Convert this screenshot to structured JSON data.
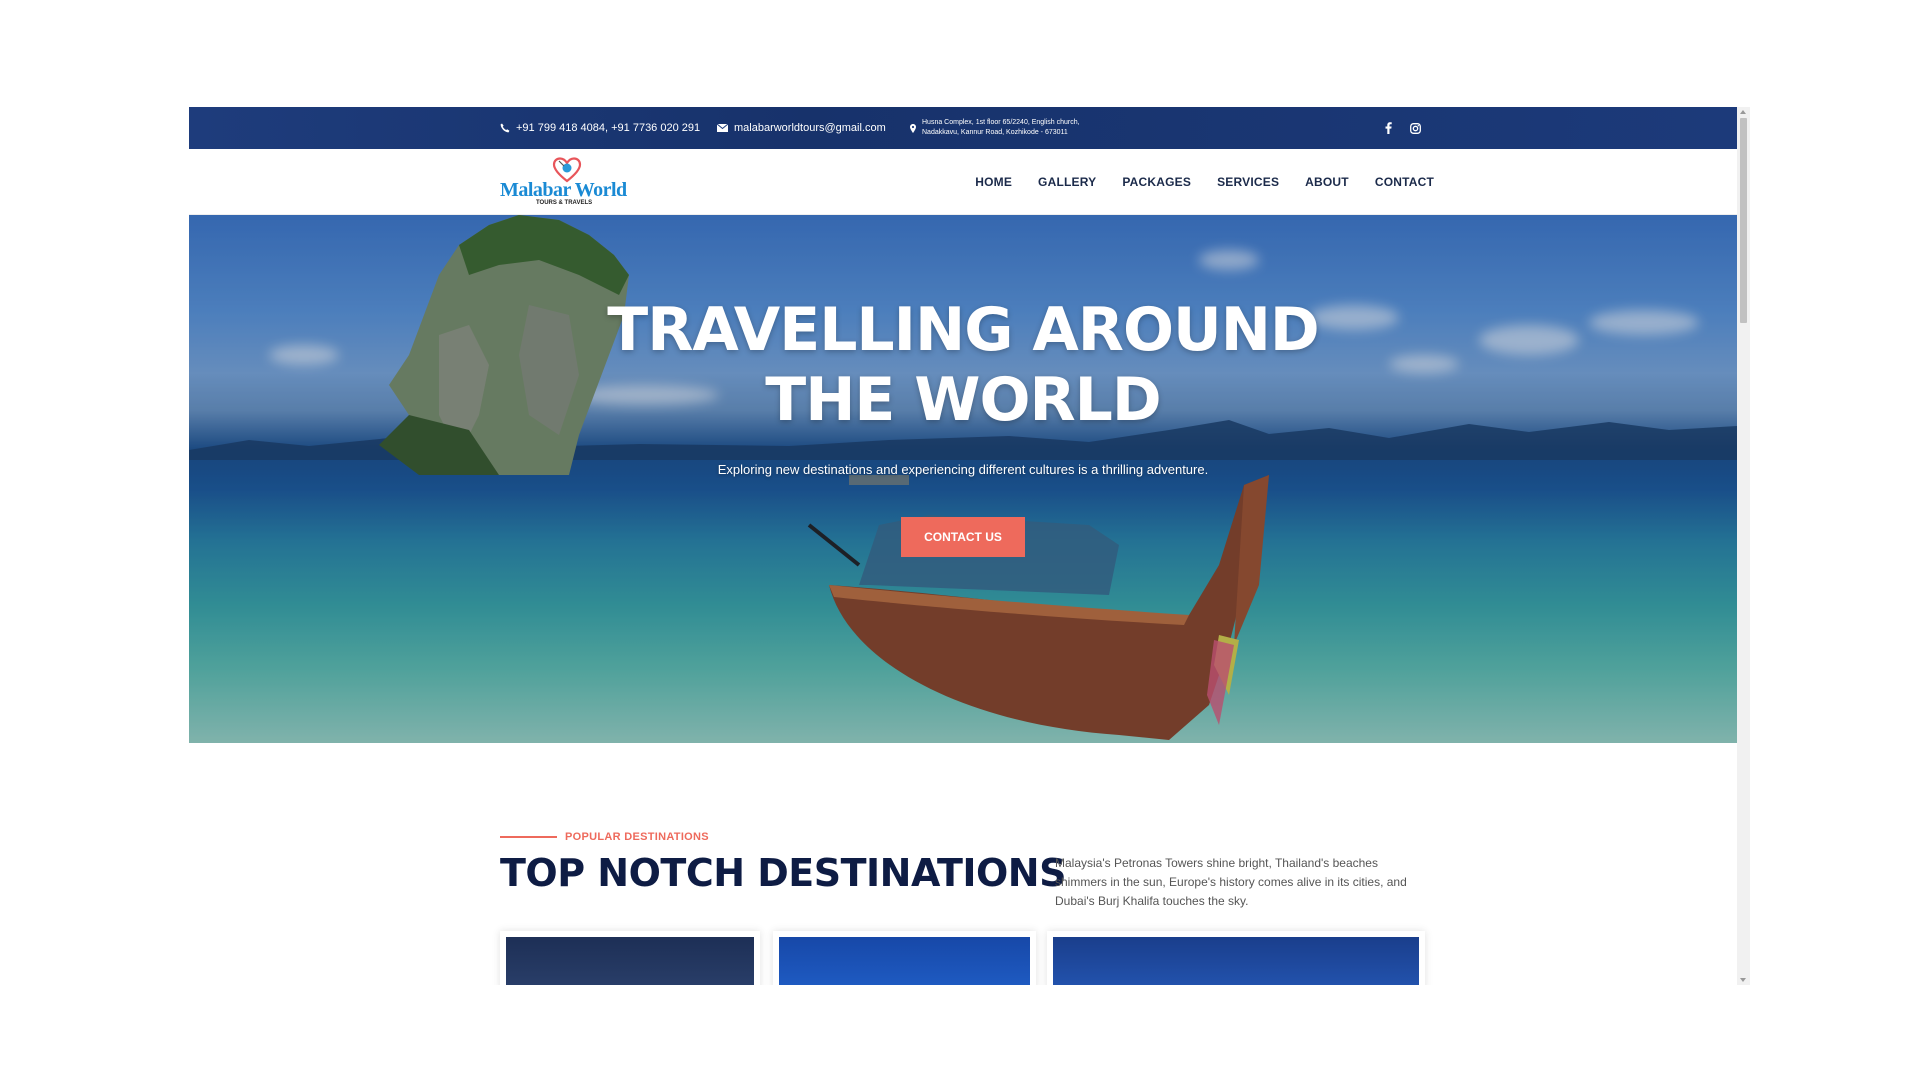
{
  "topbar": {
    "phone": "+91 799 418 4084, +91 7736 020 291",
    "email": "malabarworldtours@gmail.com",
    "address_line1": "Husna Complex, 1st floor 65/2240, English church,",
    "address_line2": "Nadakkavu, Kannur Road, Kozhikode - 673011",
    "icons": [
      "phone-icon",
      "envelope-icon",
      "map-pin-icon",
      "facebook-icon",
      "instagram-icon"
    ]
  },
  "logo": {
    "name": "Malabar World",
    "tagline": "TOURS & TRAVELS"
  },
  "nav": {
    "items": [
      {
        "label": "HOME"
      },
      {
        "label": "GALLERY"
      },
      {
        "label": "PACKAGES"
      },
      {
        "label": "SERVICES"
      },
      {
        "label": "ABOUT"
      },
      {
        "label": "CONTACT"
      }
    ]
  },
  "hero": {
    "title_line1": "TRAVELLING AROUND",
    "title_line2": "THE WORLD",
    "subtitle": "Exploring new destinations and experiencing different cultures is a thrilling adventure.",
    "cta_label": "CONTACT US"
  },
  "destinations": {
    "eyebrow": "POPULAR DESTINATIONS",
    "title": "TOP NOTCH DESTINATIONS",
    "description": "Malaysia's Petronas Towers shine bright, Thailand's beaches shimmers in the sun, Europe's history comes alive in its cities, and Dubai's Burj Khalifa touches the sky."
  },
  "colors": {
    "topbar": "#1e3c7c",
    "accent": "#ee6a5c",
    "heading": "#0e1c44",
    "nav_text": "#1b2a4a",
    "logo_blue": "#1a8ad4"
  }
}
